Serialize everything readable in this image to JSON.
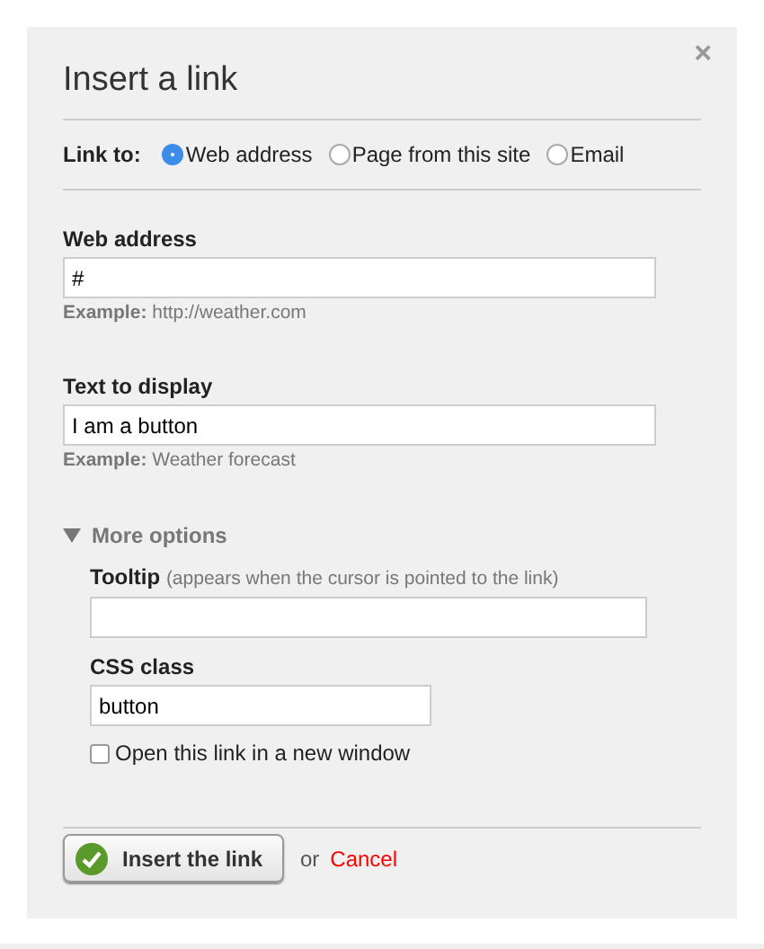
{
  "dialog": {
    "title": "Insert a link",
    "close": "×"
  },
  "link_to": {
    "label": "Link to:",
    "options": [
      {
        "label": "Web address",
        "selected": true
      },
      {
        "label": "Page from this site",
        "selected": false
      },
      {
        "label": "Email",
        "selected": false
      }
    ]
  },
  "web_address": {
    "label": "Web address",
    "value": "#",
    "example_label": "Example:",
    "example": "http://weather.com"
  },
  "text_to_display": {
    "label": "Text to display",
    "value": "I am a button",
    "example_label": "Example:",
    "example": "Weather forecast"
  },
  "more_options": {
    "label": "More options",
    "expanded": true,
    "tooltip": {
      "label": "Tooltip",
      "hint": "(appears when the cursor is pointed to the link)"
    },
    "css_class": {
      "label": "CSS class",
      "value": "button"
    },
    "new_window": {
      "label": "Open this link in a new window",
      "checked": false
    }
  },
  "footer": {
    "insert_button": "Insert the link",
    "or": "or",
    "cancel": "Cancel"
  }
}
